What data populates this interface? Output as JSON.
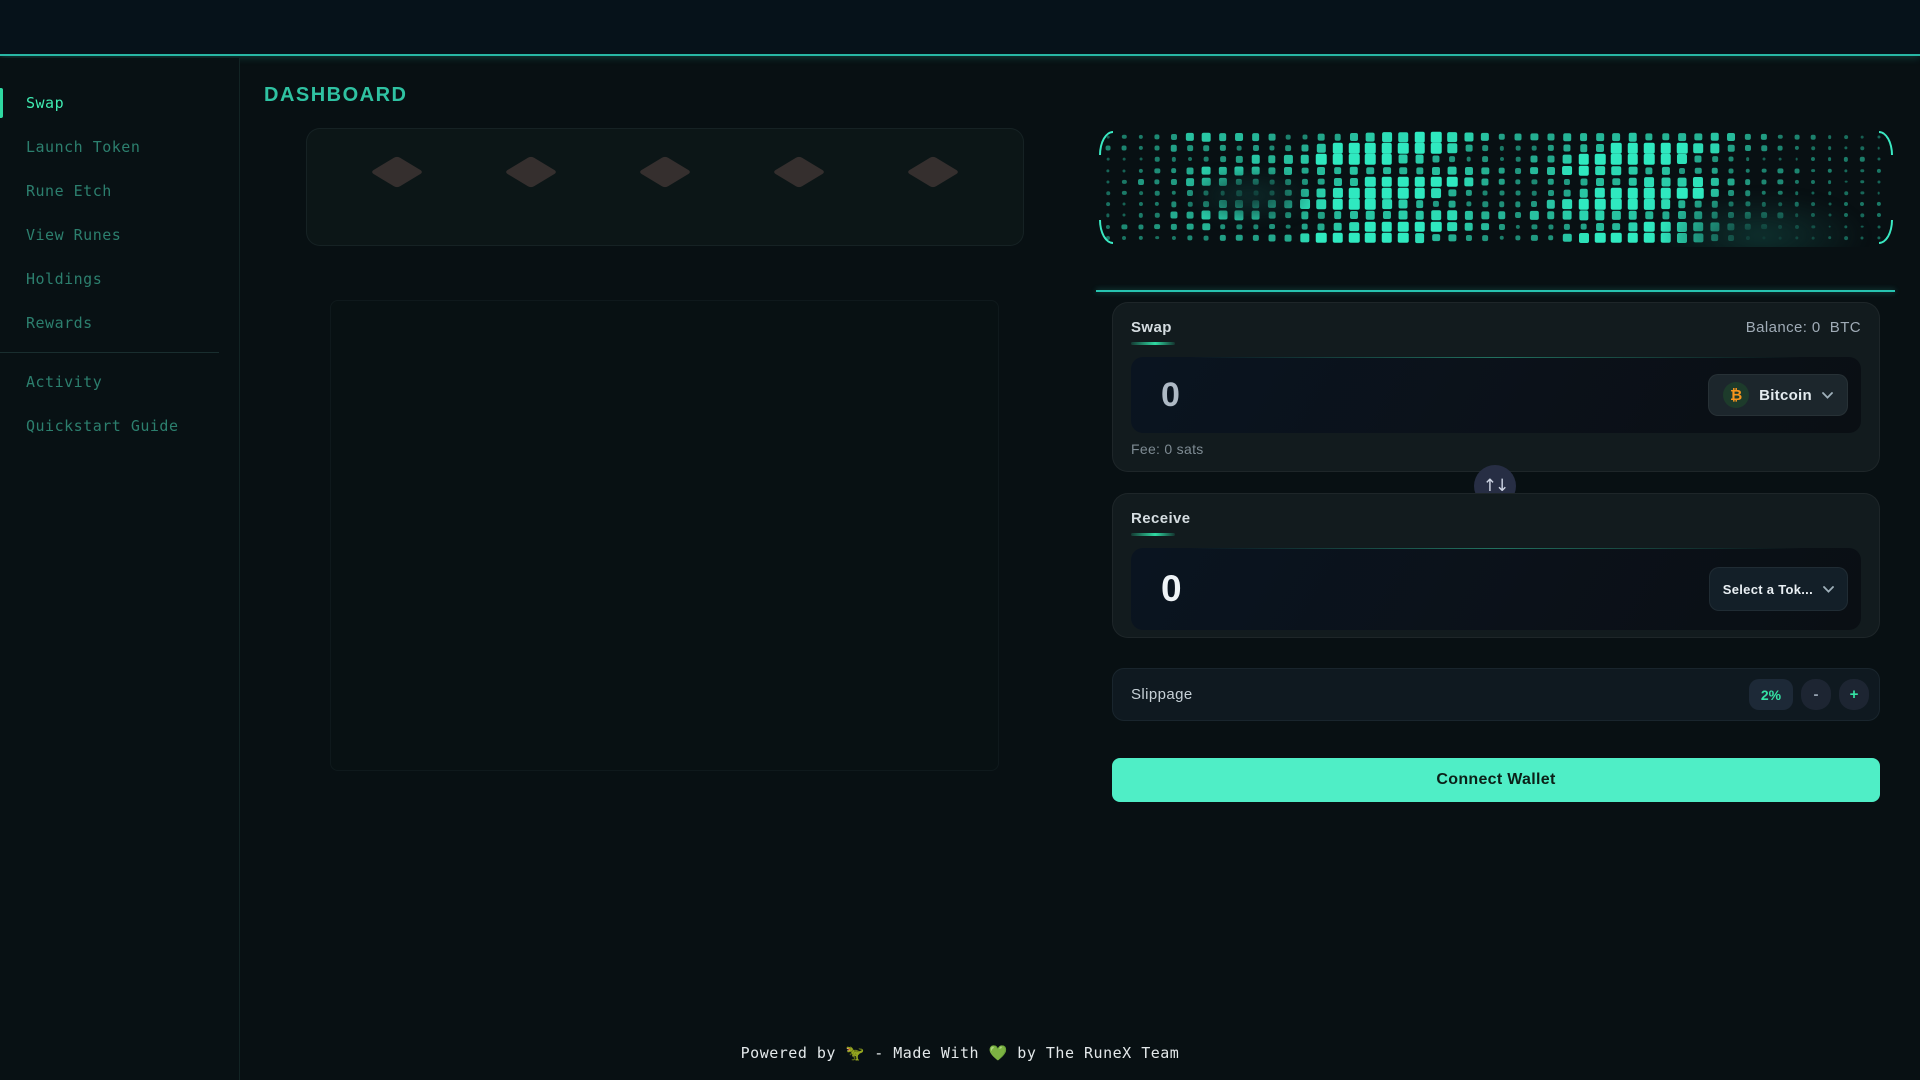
{
  "sidebar": {
    "items": [
      "Swap",
      "Launch Token",
      "Rune Etch",
      "View Runes",
      "Holdings",
      "Rewards"
    ],
    "secondary_items": [
      "Activity",
      "Quickstart Guide"
    ]
  },
  "main": {
    "title": "DASHBOARD"
  },
  "swap_widget": {
    "swap": {
      "label": "Swap",
      "balance": "Balance: 0  BTC",
      "amount": "0",
      "fee": "Fee: 0 sats",
      "token": {
        "name": "Bitcoin",
        "symbol": "₿"
      }
    },
    "direction_icon": "↑↓",
    "receive": {
      "label": "Receive",
      "amount": "0",
      "select_token": "Select a Tok..."
    },
    "slippage": {
      "label": "Slippage",
      "value": "2%",
      "decrease": "-",
      "increase": "+"
    },
    "connect_wallet": "Connect Wallet"
  },
  "footer": {
    "prefix": "Powered by ",
    "dino": "🦖",
    "mid": " - Made With ",
    "heart": "💚",
    "suffix": " by The RuneX Team"
  },
  "colors": {
    "accent_mint": "#4feec6",
    "accent_teal": "#2fd3bd",
    "nav_active": "#3fecb2",
    "nav_inactive": "#2c7f6e",
    "bitcoin_orange": "#f7941d",
    "dot_mint": "#2fe9c0",
    "slippage_green": "#35e3a4"
  }
}
